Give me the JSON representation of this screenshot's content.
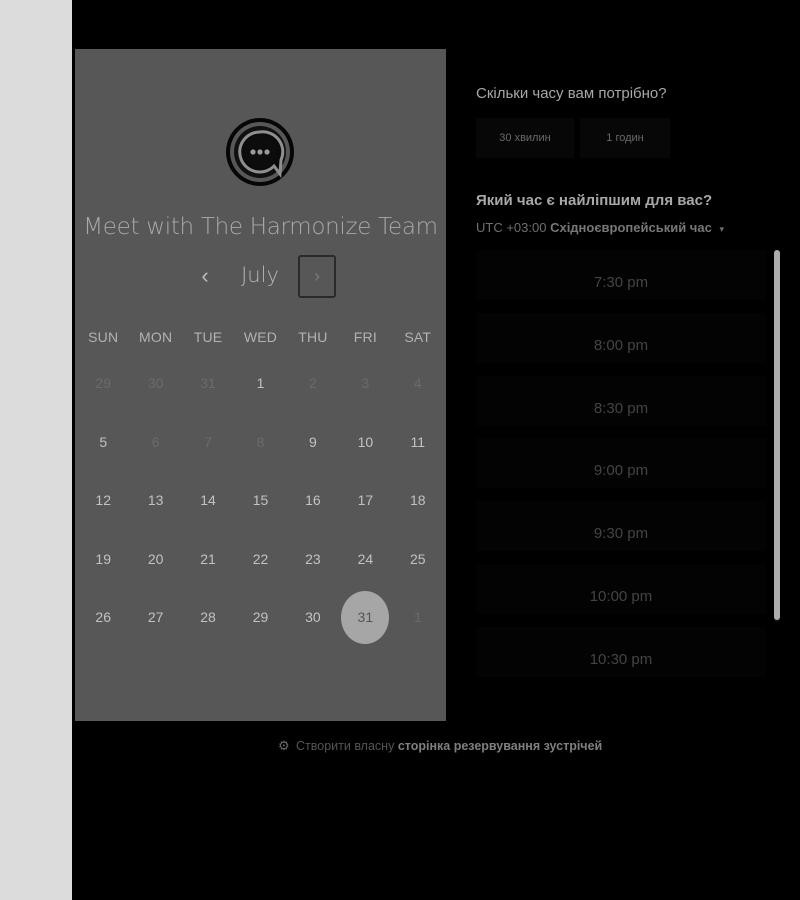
{
  "calendar": {
    "title": "Meet with The Harmonize Team",
    "month": "July",
    "prev_icon": "‹",
    "next_icon": "›",
    "weekdays": [
      "SUN",
      "MON",
      "TUE",
      "WED",
      "THU",
      "FRI",
      "SAT"
    ],
    "weeks": [
      [
        {
          "d": "29",
          "muted": true
        },
        {
          "d": "30",
          "muted": true
        },
        {
          "d": "31",
          "muted": true
        },
        {
          "d": "1",
          "muted": false
        },
        {
          "d": "2",
          "muted": true
        },
        {
          "d": "3",
          "muted": true
        },
        {
          "d": "4",
          "muted": true
        }
      ],
      [
        {
          "d": "5",
          "muted": false
        },
        {
          "d": "6",
          "muted": true
        },
        {
          "d": "7",
          "muted": true
        },
        {
          "d": "8",
          "muted": true
        },
        {
          "d": "9",
          "muted": false
        },
        {
          "d": "10",
          "muted": false
        },
        {
          "d": "11",
          "muted": false
        }
      ],
      [
        {
          "d": "12",
          "muted": false
        },
        {
          "d": "13",
          "muted": false
        },
        {
          "d": "14",
          "muted": false
        },
        {
          "d": "15",
          "muted": false
        },
        {
          "d": "16",
          "muted": false
        },
        {
          "d": "17",
          "muted": false
        },
        {
          "d": "18",
          "muted": false
        }
      ],
      [
        {
          "d": "19",
          "muted": false
        },
        {
          "d": "20",
          "muted": false
        },
        {
          "d": "21",
          "muted": false
        },
        {
          "d": "22",
          "muted": false
        },
        {
          "d": "23",
          "muted": false
        },
        {
          "d": "24",
          "muted": false
        },
        {
          "d": "25",
          "muted": false
        }
      ],
      [
        {
          "d": "26",
          "muted": false
        },
        {
          "d": "27",
          "muted": false
        },
        {
          "d": "28",
          "muted": false
        },
        {
          "d": "29",
          "muted": false
        },
        {
          "d": "30",
          "muted": false
        },
        {
          "d": "31",
          "muted": false,
          "selected": true
        },
        {
          "d": "1",
          "muted": true
        }
      ]
    ]
  },
  "duration": {
    "title": "Скільки часу вам потрібно?",
    "options": [
      "30 хвилин",
      "1 годин"
    ]
  },
  "time": {
    "title": "Який час є найліпшим для вас?",
    "tz_prefix": "UTC +03:00",
    "tz_name": "Східноєвропейський час",
    "tz_caret": "▾",
    "slots": [
      "7:30 pm",
      "8:00 pm",
      "8:30 pm",
      "9:00 pm",
      "9:30 pm",
      "10:00 pm",
      "10:30 pm"
    ]
  },
  "footer": {
    "icon": "sprocket-icon",
    "text": "Створити власну",
    "link": "сторінка резервування зустрічей"
  },
  "colors": {
    "card": "#575757",
    "selected_day": "#a6a6a6",
    "page": "#000000",
    "left_strip": "#dcdcdc"
  }
}
